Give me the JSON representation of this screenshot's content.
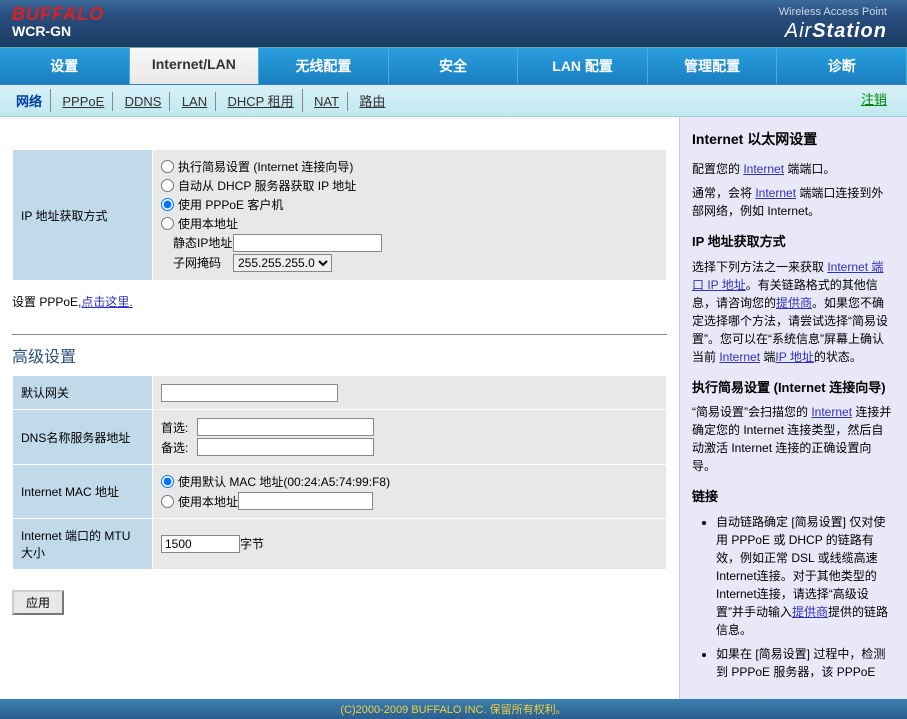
{
  "header": {
    "logo": "BUFFALO",
    "model": "WCR-GN",
    "tagline": "Wireless Access Point",
    "brand_a": "Air",
    "brand_b": "Station"
  },
  "maintabs": [
    "设置",
    "Internet/LAN",
    "无线配置",
    "安全",
    "LAN 配置",
    "管理配置",
    "诊断"
  ],
  "subtabs": [
    "网络",
    "PPPoE",
    "DDNS",
    "LAN",
    "DHCP 租用",
    "NAT",
    "路由"
  ],
  "logout": "注销",
  "ipmethod": {
    "label": "IP 地址获取方式",
    "radios": {
      "easy": "执行简易设置 (Internet 连接向导)",
      "dhcp": "自动从 DHCP 服务器获取 IP 地址",
      "pppoe": "使用 PPPoE 客户机",
      "manual": "使用本地址"
    },
    "static_ip_label": "静态IP地址",
    "netmask_label": "子网掩码",
    "netmask_value": "255.255.255.0"
  },
  "note": {
    "prefix": "设置 PPPoE,",
    "link": "点击这里."
  },
  "adv_title": "高级设置",
  "adv": {
    "gateway": "默认网关",
    "dns": "DNS名称服务器地址",
    "dns_primary": "首选:",
    "dns_secondary": "备选:",
    "mac": "Internet MAC 地址",
    "mac_default": "使用默认 MAC 地址(00:24:A5:74:99:F8)",
    "mac_manual": "使用本地址",
    "mtu": "Internet 端口的 MTU 大小",
    "mtu_value": "1500",
    "mtu_unit": "字节"
  },
  "apply": "应用",
  "side": {
    "title": "Internet 以太网设置",
    "p1a": "配置您的 ",
    "p1link": "Internet",
    "p1b": " 端端口。",
    "p2a": "通常，会将 ",
    "p2link": "Internet",
    "p2b": " 端端口连接到外部网络，例如 Internet。",
    "h_ip": "IP 地址获取方式",
    "p3a": "选择下列方法之一来获取 ",
    "p3link1": "Internet 端口 IP 地址",
    "p3b": "。有关链路格式的其他信息，请咨询您的",
    "p3link2": "提供商",
    "p3c": "。如果您不确定选择哪个方法，请尝试选择“简易设置”。您可以在“系统信息”屏幕上确认当前 ",
    "p3link3": "Internet",
    "p3d": " 端",
    "p3link4": "IP 地址",
    "p3e": "的状态。",
    "h_easy": "执行简易设置 (Internet 连接向导)",
    "p4a": "“简易设置”会扫描您的 ",
    "p4link": "Internet",
    "p4b": " 连接并确定您的 Internet 连接类型，然后自动激活 Internet 连接的正确设置向导。",
    "h_link": "链接",
    "li1a": "自动链路确定 [简易设置] 仅对使用 PPPoE 或 DHCP 的链路有效，例如正常 DSL 或线缆高速Internet连接。对于其他类型的Internet连接，请选择“高级设置”并手动输入",
    "li1link": "提供商",
    "li1b": "提供的链路信息。",
    "li2": "如果在 [简易设置] 过程中，检测到 PPPoE 服务器，该 PPPoE"
  },
  "footer": "(C)2000-2009 BUFFALO INC. 保留所有权利。"
}
